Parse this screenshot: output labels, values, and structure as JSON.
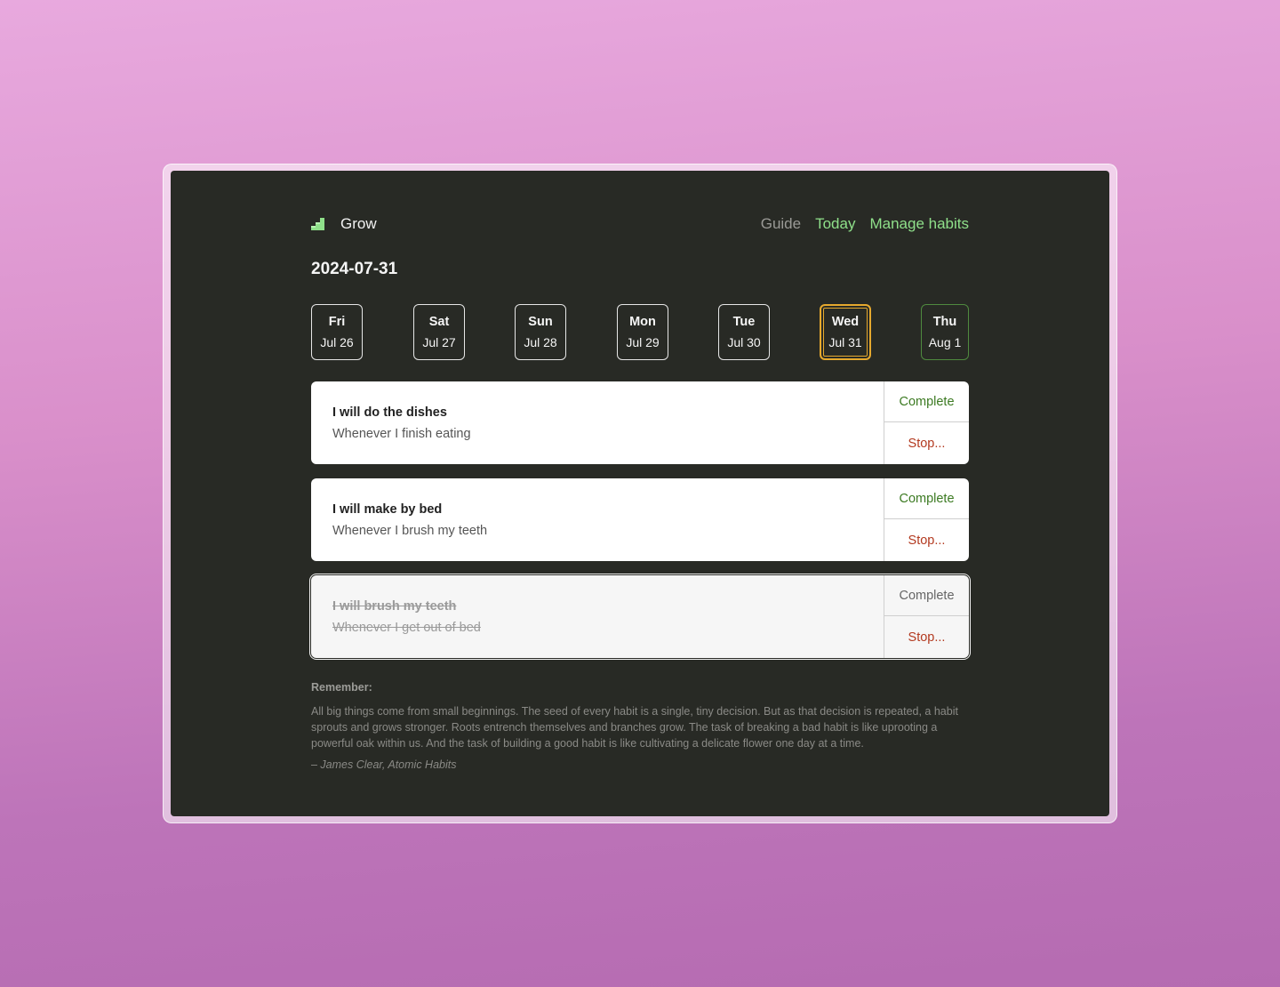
{
  "app": {
    "name": "Grow",
    "logo_icon": "bar-steps-icon",
    "accent": "#8fe08a"
  },
  "nav": {
    "guide": "Guide",
    "today": "Today",
    "manage": "Manage habits"
  },
  "date_title": "2024-07-31",
  "days": [
    {
      "name": "Fri",
      "date": "Jul 26"
    },
    {
      "name": "Sat",
      "date": "Jul 27"
    },
    {
      "name": "Sun",
      "date": "Jul 28"
    },
    {
      "name": "Mon",
      "date": "Jul 29"
    },
    {
      "name": "Tue",
      "date": "Jul 30"
    },
    {
      "name": "Wed",
      "date": "Jul 31",
      "selected": true
    },
    {
      "name": "Thu",
      "date": "Aug 1",
      "future": true
    }
  ],
  "habits": [
    {
      "title": "I will do the dishes",
      "cue": "Whenever I finish eating",
      "complete_label": "Complete",
      "stop_label": "Stop...",
      "done": false
    },
    {
      "title": "I will make by bed",
      "cue": "Whenever I brush my teeth",
      "complete_label": "Complete",
      "stop_label": "Stop...",
      "done": false
    },
    {
      "title": "I will brush my teeth",
      "cue": "Whenever I get out of bed",
      "complete_label": "Complete",
      "stop_label": "Stop...",
      "done": true
    }
  ],
  "remember": {
    "label": "Remember:",
    "quote": "All big things come from small beginnings. The seed of every habit is a single, tiny decision. But as that decision is repeated, a habit sprouts and grows stronger. Roots entrench themselves and branches grow. The task of breaking a bad habit is like uprooting a powerful oak within us. And the task of building a good habit is like cultivating a delicate flower one day at a time.",
    "attribution": "– James Clear, Atomic Habits"
  },
  "colors": {
    "window_bg": "#282a25",
    "selected_day_border": "#e6a92e",
    "future_day_border": "#4f8a3f",
    "complete_text": "#3c7a22",
    "stop_text": "#b33a20"
  }
}
